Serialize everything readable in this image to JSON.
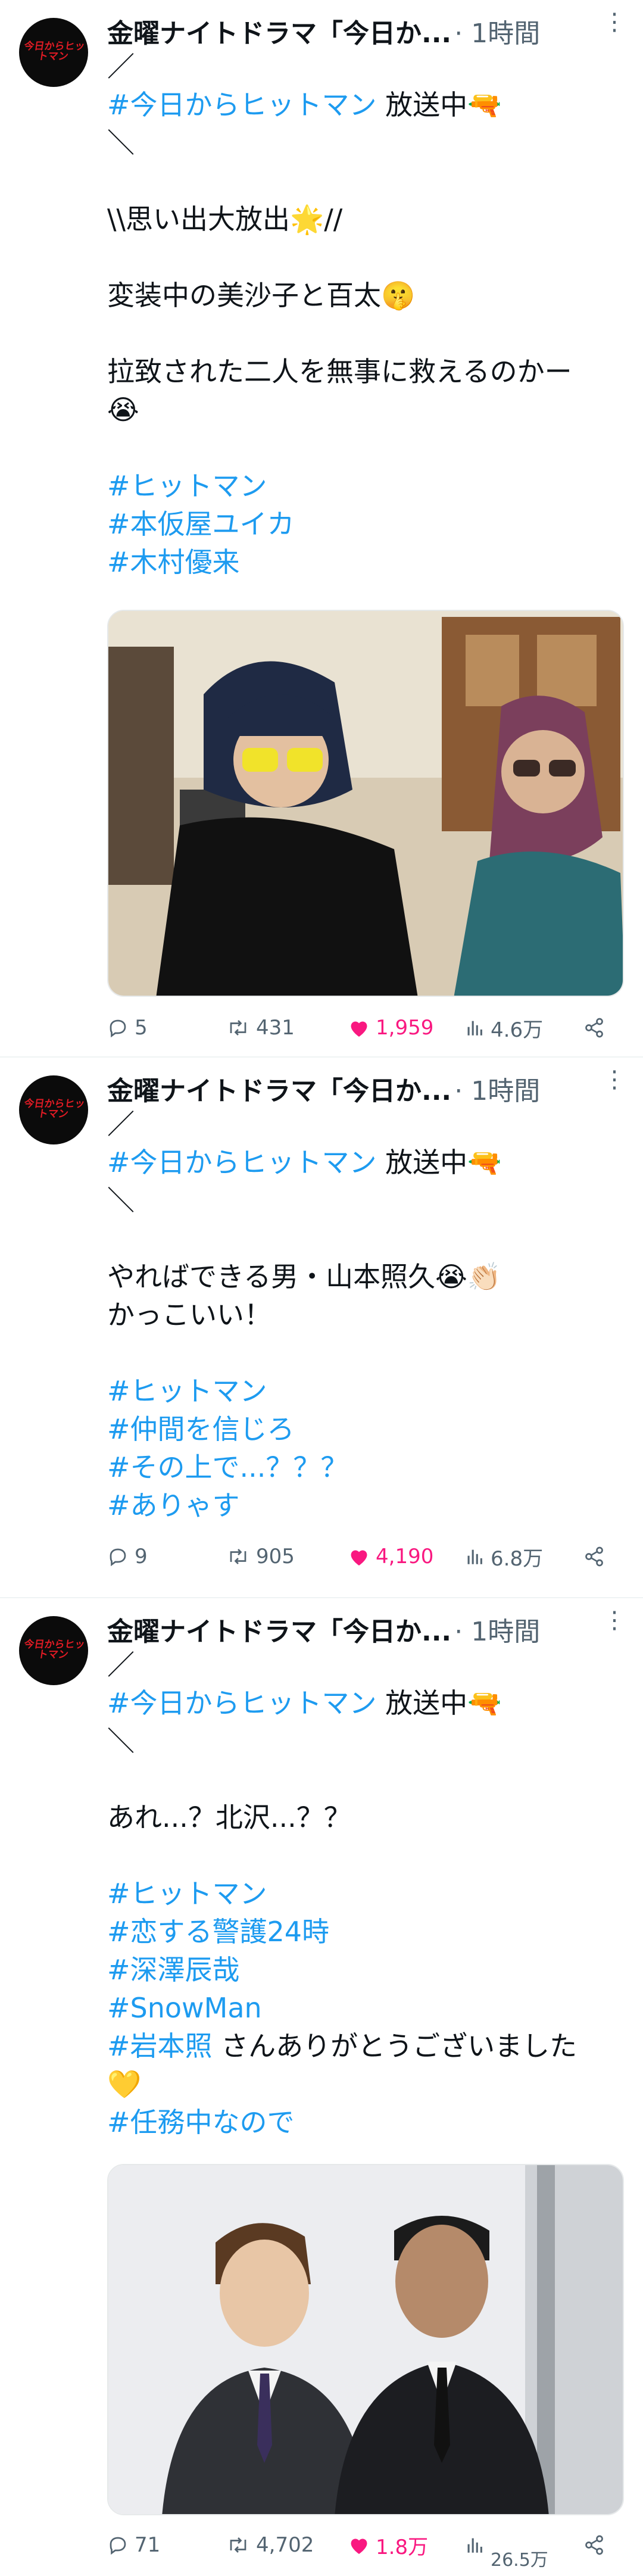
{
  "tweets": [
    {
      "avatar_text": "今日からヒットマン",
      "author": "金曜ナイトドラマ「今日か...",
      "time": "· 1時間",
      "lines": [
        {
          "text": "／"
        },
        {
          "parts": [
            {
              "t": "#今日からヒットマン",
              "tag": true
            },
            {
              "t": " 放送中🔫",
              "tag": false
            }
          ]
        },
        {
          "text": "＼"
        },
        {
          "text": ""
        },
        {
          "text": "\\\\思い出大放出🌟//"
        },
        {
          "text": ""
        },
        {
          "text": "変装中の美沙子と百太🤫"
        },
        {
          "text": ""
        },
        {
          "text": "拉致された二人を無事に救えるのかー"
        },
        {
          "text": "😭"
        },
        {
          "text": ""
        },
        {
          "tag": "#ヒットマン"
        },
        {
          "tag": "#本仮屋ユイカ"
        },
        {
          "tag": "#木村優来"
        }
      ],
      "replies": "5",
      "retweets": "431",
      "likes": "1,959",
      "views": "4.6万"
    },
    {
      "avatar_text": "今日からヒットマン",
      "author": "金曜ナイトドラマ「今日か...",
      "time": "· 1時間",
      "lines": [
        {
          "text": "／"
        },
        {
          "parts": [
            {
              "t": "#今日からヒットマン",
              "tag": true
            },
            {
              "t": " 放送中🔫",
              "tag": false
            }
          ]
        },
        {
          "text": "＼"
        },
        {
          "text": ""
        },
        {
          "text": "やればできる男・山本照久😭👏🏻"
        },
        {
          "text": "かっこいい！"
        },
        {
          "text": ""
        },
        {
          "tag": "#ヒットマン"
        },
        {
          "tag": "#仲間を信じろ"
        },
        {
          "tag": "#その上で...？？？"
        },
        {
          "tag": "#ありゃす"
        }
      ],
      "replies": "9",
      "retweets": "905",
      "likes": "4,190",
      "views": "6.8万"
    },
    {
      "avatar_text": "今日からヒットマン",
      "author": "金曜ナイトドラマ「今日か...",
      "time": "· 1時間",
      "lines": [
        {
          "text": "／"
        },
        {
          "parts": [
            {
              "t": "#今日からヒットマン",
              "tag": true
            },
            {
              "t": " 放送中🔫",
              "tag": false
            }
          ]
        },
        {
          "text": "＼"
        },
        {
          "text": ""
        },
        {
          "text": "あれ...？北沢...？？"
        },
        {
          "text": ""
        },
        {
          "tag": "#ヒットマン"
        },
        {
          "tag": "#恋する警護24時"
        },
        {
          "tag": "#深澤辰哉"
        },
        {
          "tag": "#SnowMan"
        },
        {
          "parts": [
            {
              "t": "#岩本照",
              "tag": true
            },
            {
              "t": " さんありがとうございました",
              "tag": false
            }
          ]
        },
        {
          "text": "💛"
        },
        {
          "tag": "#任務中なので"
        }
      ],
      "replies": "71",
      "retweets": "4,702",
      "likes": "1.8万",
      "views": "26.5万"
    }
  ],
  "colors": {
    "hashtag": "#1d9bf0",
    "like": "#f91880",
    "meta": "#536471"
  }
}
